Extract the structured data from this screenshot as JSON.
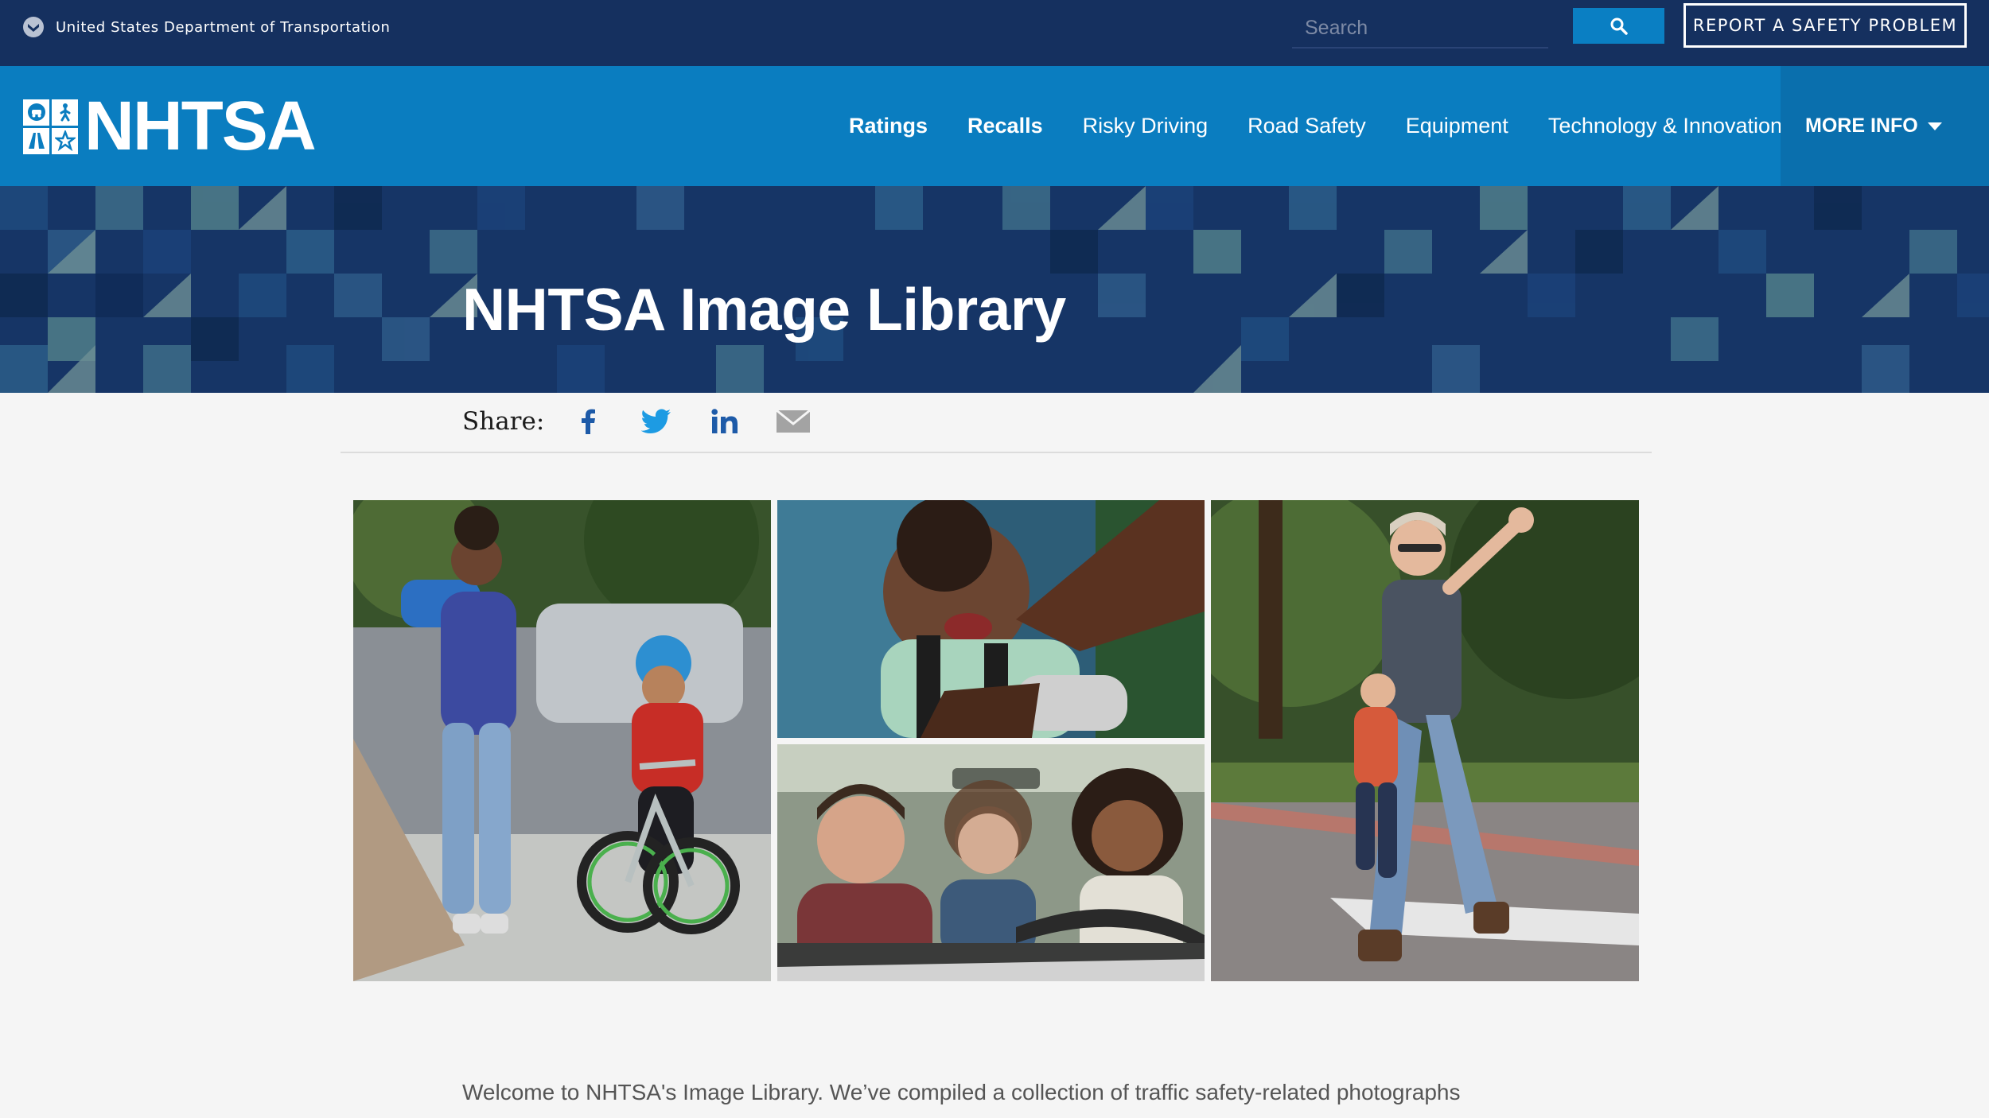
{
  "topbar": {
    "department": "United States Department of Transportation",
    "search_placeholder": "Search",
    "search_icon": "search-icon",
    "report_label": "REPORT A SAFETY PROBLEM"
  },
  "brand": {
    "name": "NHTSA"
  },
  "nav": {
    "items": [
      {
        "label": "Ratings"
      },
      {
        "label": "Recalls"
      },
      {
        "label": "Risky Driving"
      },
      {
        "label": "Road Safety"
      },
      {
        "label": "Equipment"
      },
      {
        "label": "Technology & Innovation"
      }
    ],
    "more_label": "MORE INFO"
  },
  "hero": {
    "title": "NHTSA Image Library"
  },
  "share": {
    "label": "Share:",
    "icons": [
      "facebook-icon",
      "twitter-icon",
      "linkedin-icon",
      "email-icon"
    ]
  },
  "intro": {
    "text": "Welcome to NHTSA's Image Library. We’ve compiled a collection of traffic safety-related photographs"
  },
  "colors": {
    "topbar": "#15305f",
    "nav": "#0a7dc0",
    "more_info": "#0a6fad",
    "accent": "#0a7fc3"
  }
}
